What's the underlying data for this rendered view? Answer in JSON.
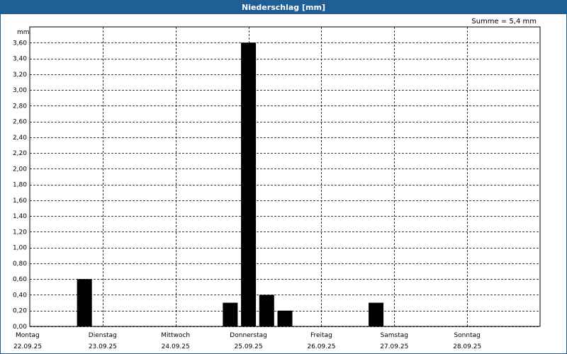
{
  "window": {
    "title": "Niederschlag [mm]"
  },
  "summary": {
    "text": "Summe = 5,4 mm"
  },
  "colors": {
    "titlebar": "#1f5f96",
    "bars": "#000000",
    "grid": "#000000"
  },
  "chart_data": {
    "type": "bar",
    "ylabel": "mm",
    "ylim": [
      0,
      3.8
    ],
    "yticks": [
      "0,00",
      "0,20",
      "0,40",
      "0,60",
      "0,80",
      "1,00",
      "1,20",
      "1,40",
      "1,60",
      "1,80",
      "2,00",
      "2,20",
      "2,40",
      "2,60",
      "2,80",
      "3,00",
      "3,20",
      "3,40",
      "3,60"
    ],
    "grid": true,
    "days": [
      {
        "day": "Montag",
        "date": "22.09.25"
      },
      {
        "day": "Dienstag",
        "date": "23.09.25"
      },
      {
        "day": "Mittwoch",
        "date": "24.09.25"
      },
      {
        "day": "Donnerstag",
        "date": "25.09.25"
      },
      {
        "day": "Freitag",
        "date": "26.09.25"
      },
      {
        "day": "Samstag",
        "date": "27.09.25"
      },
      {
        "day": "Sonntag",
        "date": "28.09.25"
      }
    ],
    "x_unit": "days since 22.09.25 00:00",
    "bars": [
      {
        "t": 0.75,
        "value": 0.6
      },
      {
        "t": 2.75,
        "value": 0.3
      },
      {
        "t": 3.0,
        "value": 3.6
      },
      {
        "t": 3.25,
        "value": 0.4
      },
      {
        "t": 3.5,
        "value": 0.2
      },
      {
        "t": 4.75,
        "value": 0.3
      }
    ],
    "total": 5.4
  }
}
